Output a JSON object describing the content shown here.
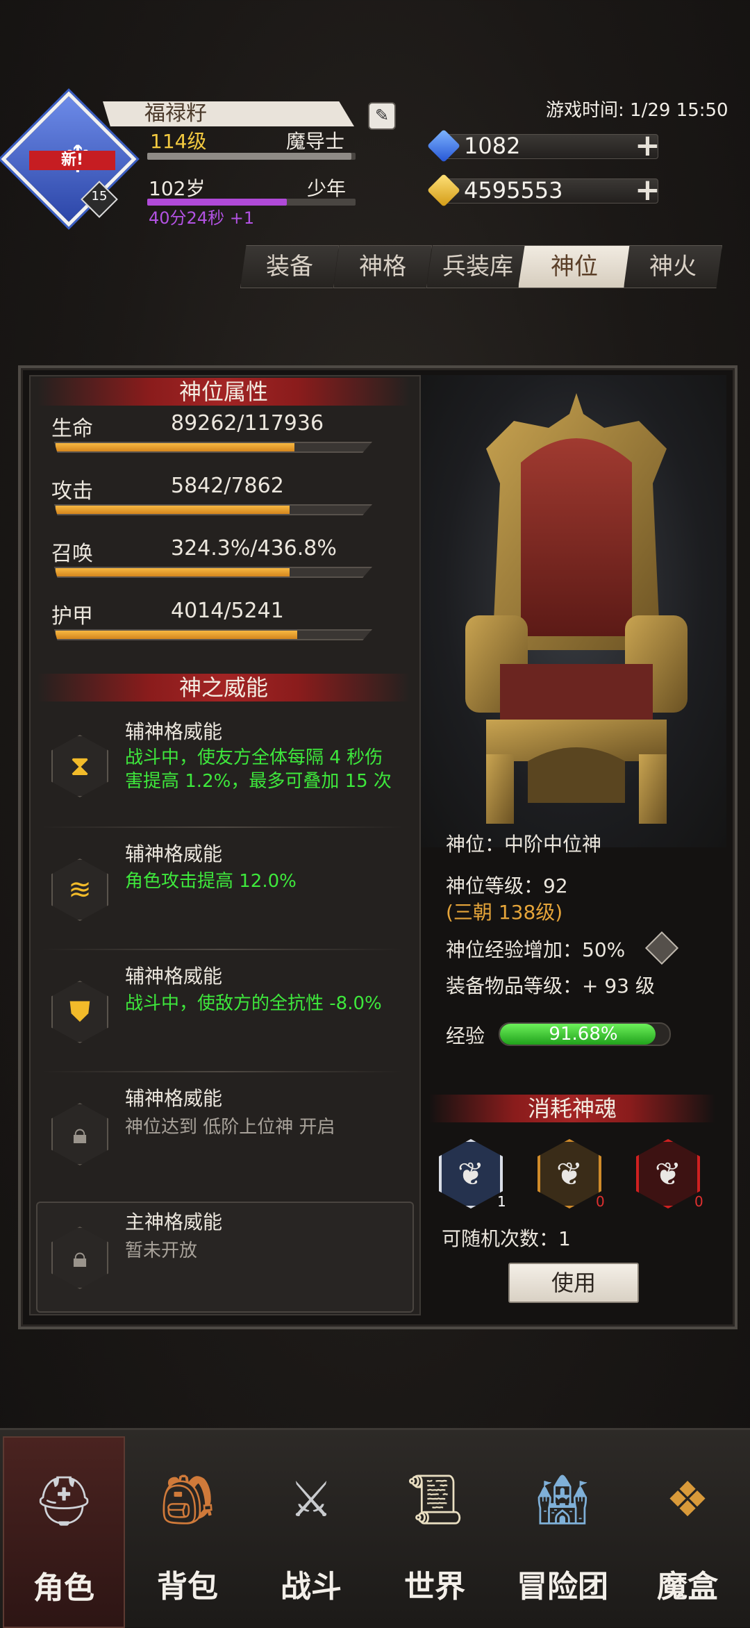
{
  "header": {
    "avatar_badge": "新!",
    "avatar_level": "15",
    "player_name": "福禄籽",
    "level": "114级",
    "class": "魔导士",
    "age": "102岁",
    "age_stage": "少年",
    "timer": "40分24秒 +1",
    "game_time": "游戏时间: 1/29 15:50",
    "gem_amount": "1082",
    "gold_amount": "4595553",
    "level_progress": 0.98,
    "age_progress": 0.67
  },
  "tabs": [
    {
      "label": "装备",
      "active": false
    },
    {
      "label": "神格",
      "active": false
    },
    {
      "label": "兵装库",
      "active": false
    },
    {
      "label": "神位",
      "active": true
    },
    {
      "label": "神火",
      "active": false
    }
  ],
  "attributes": {
    "title": "神位属性",
    "items": [
      {
        "label": "生命",
        "value": "89262/117936",
        "ratio": 0.757
      },
      {
        "label": "攻击",
        "value": "5842/7862",
        "ratio": 0.743
      },
      {
        "label": "召唤",
        "value": "324.3%/436.8%",
        "ratio": 0.742
      },
      {
        "label": "护甲",
        "value": "4014/5241",
        "ratio": 0.766
      }
    ]
  },
  "powers": {
    "title": "神之威能",
    "items": [
      {
        "title": "辅神格威能",
        "line1": "战斗中，使友方全体每隔 4 秒伤",
        "line2": "害提高 1.2%，最多可叠加 15 次",
        "icon": "hourglass-icon",
        "locked": false
      },
      {
        "title": "辅神格威能",
        "line1": "角色攻击提高 12.0%",
        "line2": "",
        "icon": "flame-icon",
        "locked": false
      },
      {
        "title": "辅神格威能",
        "line1": "战斗中，使敌方的全抗性 -8.0%",
        "line2": "",
        "icon": "shield-break-icon",
        "locked": false
      },
      {
        "title": "辅神格威能",
        "line1": "神位达到 低阶上位神 开启",
        "line2": "",
        "icon": "lock-icon",
        "locked": true
      }
    ],
    "main": {
      "title": "主神格威能",
      "desc": "暂未开放"
    }
  },
  "divine": {
    "rank": "神位：中阶中位神",
    "level": "神位等级：92",
    "level_extra": "(三朝 138级)",
    "exp_bonus": "神位经验增加：50%",
    "equip_level": "装备物品等级：+ 93 级",
    "exp_label": "经验",
    "exp_value": "91.68%",
    "exp_ratio": 0.9168
  },
  "souls": {
    "title": "消耗神魂",
    "items": [
      {
        "count": "1",
        "border": "#d9dde6",
        "bg": "#25324e",
        "count_color": "#ffffff"
      },
      {
        "count": "0",
        "border": "#d08b2a",
        "bg": "#3a2c18",
        "count_color": "#e03030"
      },
      {
        "count": "0",
        "border": "#cf2020",
        "bg": "#3d1212",
        "count_color": "#e03030"
      }
    ],
    "random_count": "可随机次数：1",
    "use_label": "使用"
  },
  "nav": [
    {
      "label": "角色",
      "icon": "helmet-icon",
      "active": true
    },
    {
      "label": "背包",
      "icon": "backpack-icon",
      "active": false
    },
    {
      "label": "战斗",
      "icon": "sword-shield-icon",
      "active": false
    },
    {
      "label": "世界",
      "icon": "scroll-icon",
      "active": false
    },
    {
      "label": "冒险团",
      "icon": "castle-icon",
      "active": false
    },
    {
      "label": "魔盒",
      "icon": "magic-box-icon",
      "active": false
    }
  ]
}
